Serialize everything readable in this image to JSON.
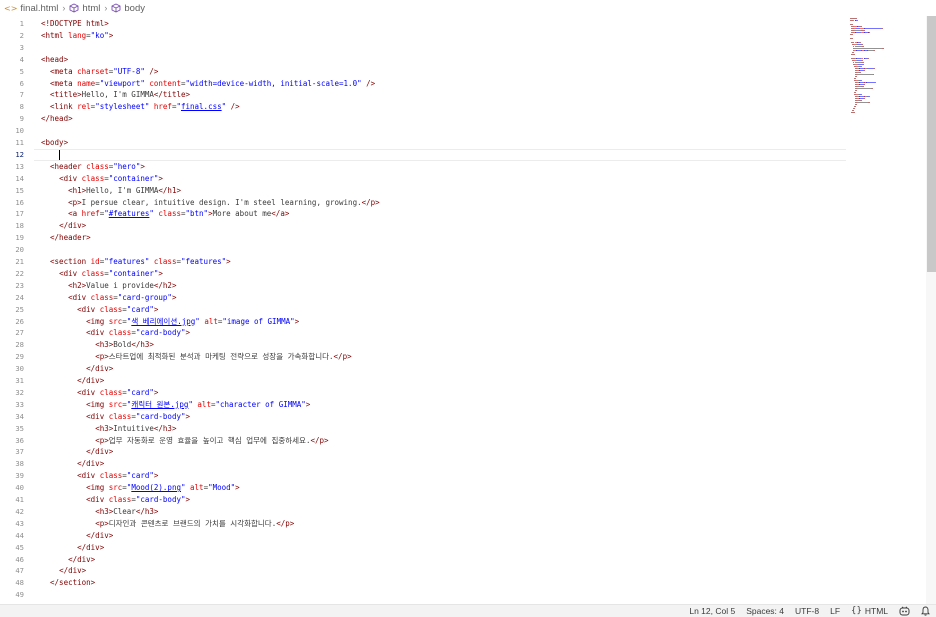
{
  "breadcrumb": {
    "file": "final.html",
    "items": [
      "html",
      "body"
    ]
  },
  "editor": {
    "current_line": 12,
    "lines": [
      [
        [
          "doc",
          "<!DOCTYPE html>"
        ]
      ],
      [
        [
          "tag",
          "<html "
        ],
        [
          "attr",
          "lang"
        ],
        [
          "txt",
          "="
        ],
        [
          "val",
          "\"ko\""
        ],
        [
          "tag",
          ">"
        ]
      ],
      [],
      [
        [
          "tag",
          "<head>"
        ]
      ],
      [
        [
          "txt",
          "  "
        ],
        [
          "tag",
          "<meta "
        ],
        [
          "attr",
          "charset"
        ],
        [
          "txt",
          "="
        ],
        [
          "val",
          "\"UTF-8\""
        ],
        [
          "tag",
          " />"
        ]
      ],
      [
        [
          "txt",
          "  "
        ],
        [
          "tag",
          "<meta "
        ],
        [
          "attr",
          "name"
        ],
        [
          "txt",
          "="
        ],
        [
          "val",
          "\"viewport\""
        ],
        [
          "attr",
          " content"
        ],
        [
          "txt",
          "="
        ],
        [
          "val",
          "\"width=device-width, initial-scale=1.0\""
        ],
        [
          "tag",
          " />"
        ]
      ],
      [
        [
          "txt",
          "  "
        ],
        [
          "tag",
          "<title>"
        ],
        [
          "txt",
          "Hello, I'm GIMMA"
        ],
        [
          "tag",
          "</title>"
        ]
      ],
      [
        [
          "txt",
          "  "
        ],
        [
          "tag",
          "<link "
        ],
        [
          "attr",
          "rel"
        ],
        [
          "txt",
          "="
        ],
        [
          "val",
          "\"stylesheet\""
        ],
        [
          "attr",
          " href"
        ],
        [
          "txt",
          "="
        ],
        [
          "val",
          "\""
        ],
        [
          "link",
          "final.css"
        ],
        [
          "val",
          "\""
        ],
        [
          "tag",
          " />"
        ]
      ],
      [
        [
          "tag",
          "</head>"
        ]
      ],
      [],
      [
        [
          "tag",
          "<body>"
        ]
      ],
      [],
      [
        [
          "txt",
          "  "
        ],
        [
          "tag",
          "<header "
        ],
        [
          "attr",
          "class"
        ],
        [
          "txt",
          "="
        ],
        [
          "val",
          "\"hero\""
        ],
        [
          "tag",
          ">"
        ]
      ],
      [
        [
          "txt",
          "    "
        ],
        [
          "tag",
          "<div "
        ],
        [
          "attr",
          "class"
        ],
        [
          "txt",
          "="
        ],
        [
          "val",
          "\"container\""
        ],
        [
          "tag",
          ">"
        ]
      ],
      [
        [
          "txt",
          "      "
        ],
        [
          "tag",
          "<h1>"
        ],
        [
          "txt",
          "Hello, I'm GIMMA"
        ],
        [
          "tag",
          "</h1>"
        ]
      ],
      [
        [
          "txt",
          "      "
        ],
        [
          "tag",
          "<p>"
        ],
        [
          "txt",
          "I persue clear, intuitive design. I'm steel learning, growing."
        ],
        [
          "tag",
          "</p>"
        ]
      ],
      [
        [
          "txt",
          "      "
        ],
        [
          "tag",
          "<a "
        ],
        [
          "attr",
          "href"
        ],
        [
          "txt",
          "="
        ],
        [
          "val",
          "\""
        ],
        [
          "link",
          "#features"
        ],
        [
          "val",
          "\""
        ],
        [
          "attr",
          " class"
        ],
        [
          "txt",
          "="
        ],
        [
          "val",
          "\"btn\""
        ],
        [
          "tag",
          ">"
        ],
        [
          "txt",
          "More about me"
        ],
        [
          "tag",
          "</a>"
        ]
      ],
      [
        [
          "txt",
          "    "
        ],
        [
          "tag",
          "</div>"
        ]
      ],
      [
        [
          "txt",
          "  "
        ],
        [
          "tag",
          "</header>"
        ]
      ],
      [],
      [
        [
          "txt",
          "  "
        ],
        [
          "tag",
          "<section "
        ],
        [
          "attr",
          "id"
        ],
        [
          "txt",
          "="
        ],
        [
          "val",
          "\"features\""
        ],
        [
          "attr",
          " class"
        ],
        [
          "txt",
          "="
        ],
        [
          "val",
          "\"features\""
        ],
        [
          "tag",
          ">"
        ]
      ],
      [
        [
          "txt",
          "    "
        ],
        [
          "tag",
          "<div "
        ],
        [
          "attr",
          "class"
        ],
        [
          "txt",
          "="
        ],
        [
          "val",
          "\"container\""
        ],
        [
          "tag",
          ">"
        ]
      ],
      [
        [
          "txt",
          "      "
        ],
        [
          "tag",
          "<h2>"
        ],
        [
          "txt",
          "Value i provide"
        ],
        [
          "tag",
          "</h2>"
        ]
      ],
      [
        [
          "txt",
          "      "
        ],
        [
          "tag",
          "<div "
        ],
        [
          "attr",
          "class"
        ],
        [
          "txt",
          "="
        ],
        [
          "val",
          "\"card-group\""
        ],
        [
          "tag",
          ">"
        ]
      ],
      [
        [
          "txt",
          "        "
        ],
        [
          "tag",
          "<div "
        ],
        [
          "attr",
          "class"
        ],
        [
          "txt",
          "="
        ],
        [
          "val",
          "\"card\""
        ],
        [
          "tag",
          ">"
        ]
      ],
      [
        [
          "txt",
          "          "
        ],
        [
          "tag",
          "<img "
        ],
        [
          "attr",
          "src"
        ],
        [
          "txt",
          "="
        ],
        [
          "val",
          "\""
        ],
        [
          "link",
          "색 베리에이션.jpg"
        ],
        [
          "val",
          "\""
        ],
        [
          "attr",
          " alt"
        ],
        [
          "txt",
          "="
        ],
        [
          "val",
          "\"image of GIMMA\""
        ],
        [
          "tag",
          ">"
        ]
      ],
      [
        [
          "txt",
          "          "
        ],
        [
          "tag",
          "<div "
        ],
        [
          "attr",
          "class"
        ],
        [
          "txt",
          "="
        ],
        [
          "val",
          "\"card-body\""
        ],
        [
          "tag",
          ">"
        ]
      ],
      [
        [
          "txt",
          "            "
        ],
        [
          "tag",
          "<h3>"
        ],
        [
          "txt",
          "Bold"
        ],
        [
          "tag",
          "</h3>"
        ]
      ],
      [
        [
          "txt",
          "            "
        ],
        [
          "tag",
          "<p>"
        ],
        [
          "txt",
          "스타트업에 최적화된 분석과 마케팅 전략으로 성장을 가속화합니다."
        ],
        [
          "tag",
          "</p>"
        ]
      ],
      [
        [
          "txt",
          "          "
        ],
        [
          "tag",
          "</div>"
        ]
      ],
      [
        [
          "txt",
          "        "
        ],
        [
          "tag",
          "</div>"
        ]
      ],
      [
        [
          "txt",
          "        "
        ],
        [
          "tag",
          "<div "
        ],
        [
          "attr",
          "class"
        ],
        [
          "txt",
          "="
        ],
        [
          "val",
          "\"card\""
        ],
        [
          "tag",
          ">"
        ]
      ],
      [
        [
          "txt",
          "          "
        ],
        [
          "tag",
          "<img "
        ],
        [
          "attr",
          "src"
        ],
        [
          "txt",
          "="
        ],
        [
          "val",
          "\""
        ],
        [
          "link",
          "캐릭터 원본.jpg"
        ],
        [
          "val",
          "\""
        ],
        [
          "attr",
          " alt"
        ],
        [
          "txt",
          "="
        ],
        [
          "val",
          "\"character of GIMMA\""
        ],
        [
          "tag",
          ">"
        ]
      ],
      [
        [
          "txt",
          "          "
        ],
        [
          "tag",
          "<div "
        ],
        [
          "attr",
          "class"
        ],
        [
          "txt",
          "="
        ],
        [
          "val",
          "\"card-body\""
        ],
        [
          "tag",
          ">"
        ]
      ],
      [
        [
          "txt",
          "            "
        ],
        [
          "tag",
          "<h3>"
        ],
        [
          "txt",
          "Intuitive"
        ],
        [
          "tag",
          "</h3>"
        ]
      ],
      [
        [
          "txt",
          "            "
        ],
        [
          "tag",
          "<p>"
        ],
        [
          "txt",
          "업무 자동화로 운영 효율을 높이고 핵심 업무에 집중하세요."
        ],
        [
          "tag",
          "</p>"
        ]
      ],
      [
        [
          "txt",
          "          "
        ],
        [
          "tag",
          "</div>"
        ]
      ],
      [
        [
          "txt",
          "        "
        ],
        [
          "tag",
          "</div>"
        ]
      ],
      [
        [
          "txt",
          "        "
        ],
        [
          "tag",
          "<div "
        ],
        [
          "attr",
          "class"
        ],
        [
          "txt",
          "="
        ],
        [
          "val",
          "\"card\""
        ],
        [
          "tag",
          ">"
        ]
      ],
      [
        [
          "txt",
          "          "
        ],
        [
          "tag",
          "<img "
        ],
        [
          "attr",
          "src"
        ],
        [
          "txt",
          "="
        ],
        [
          "val",
          "\""
        ],
        [
          "link",
          "Mood(2).png"
        ],
        [
          "val",
          "\""
        ],
        [
          "attr",
          " alt"
        ],
        [
          "txt",
          "="
        ],
        [
          "val",
          "\"Mood\""
        ],
        [
          "tag",
          ">"
        ]
      ],
      [
        [
          "txt",
          "          "
        ],
        [
          "tag",
          "<div "
        ],
        [
          "attr",
          "class"
        ],
        [
          "txt",
          "="
        ],
        [
          "val",
          "\"card-body\""
        ],
        [
          "tag",
          ">"
        ]
      ],
      [
        [
          "txt",
          "            "
        ],
        [
          "tag",
          "<h3>"
        ],
        [
          "txt",
          "Clear"
        ],
        [
          "tag",
          "</h3>"
        ]
      ],
      [
        [
          "txt",
          "            "
        ],
        [
          "tag",
          "<p>"
        ],
        [
          "txt",
          "디자인과 콘텐츠로 브랜드의 가치를 시각화합니다."
        ],
        [
          "tag",
          "</p>"
        ]
      ],
      [
        [
          "txt",
          "          "
        ],
        [
          "tag",
          "</div>"
        ]
      ],
      [
        [
          "txt",
          "        "
        ],
        [
          "tag",
          "</div>"
        ]
      ],
      [
        [
          "txt",
          "      "
        ],
        [
          "tag",
          "</div>"
        ]
      ],
      [
        [
          "txt",
          "    "
        ],
        [
          "tag",
          "</div>"
        ]
      ],
      [
        [
          "txt",
          "  "
        ],
        [
          "tag",
          "</section>"
        ]
      ],
      [],
      []
    ]
  },
  "colors": {
    "tag": "#800000",
    "attr": "#e50000",
    "val": "#0000ff",
    "link": "#0000ff",
    "doc": "#800000",
    "txt": "#3b3b3b"
  },
  "statusbar": {
    "position": "Ln 12, Col 5",
    "spaces": "Spaces: 4",
    "encoding": "UTF-8",
    "eol": "LF",
    "language": "HTML",
    "language_icon": "braces-icon",
    "copilot_icon": "copilot-icon",
    "bell_icon": "bell-icon"
  }
}
